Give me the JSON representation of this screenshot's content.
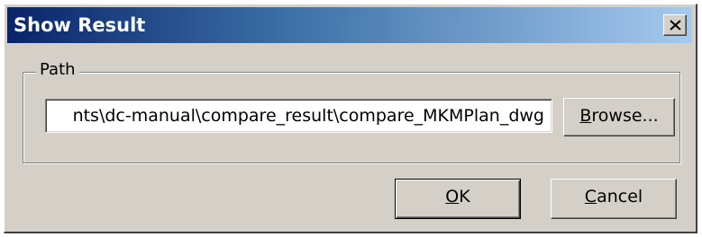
{
  "window": {
    "title": "Show Result",
    "close_icon": "close-x-icon"
  },
  "path_group": {
    "label": "Path",
    "input_value": "nts\\dc-manual\\compare_result\\compare_MKMPlan_dwg",
    "browse_label_mnemonic": "B",
    "browse_label_rest": "rowse..."
  },
  "buttons": {
    "ok_mnemonic": "O",
    "ok_rest": "K",
    "cancel_mnemonic": "C",
    "cancel_rest": "ancel"
  }
}
